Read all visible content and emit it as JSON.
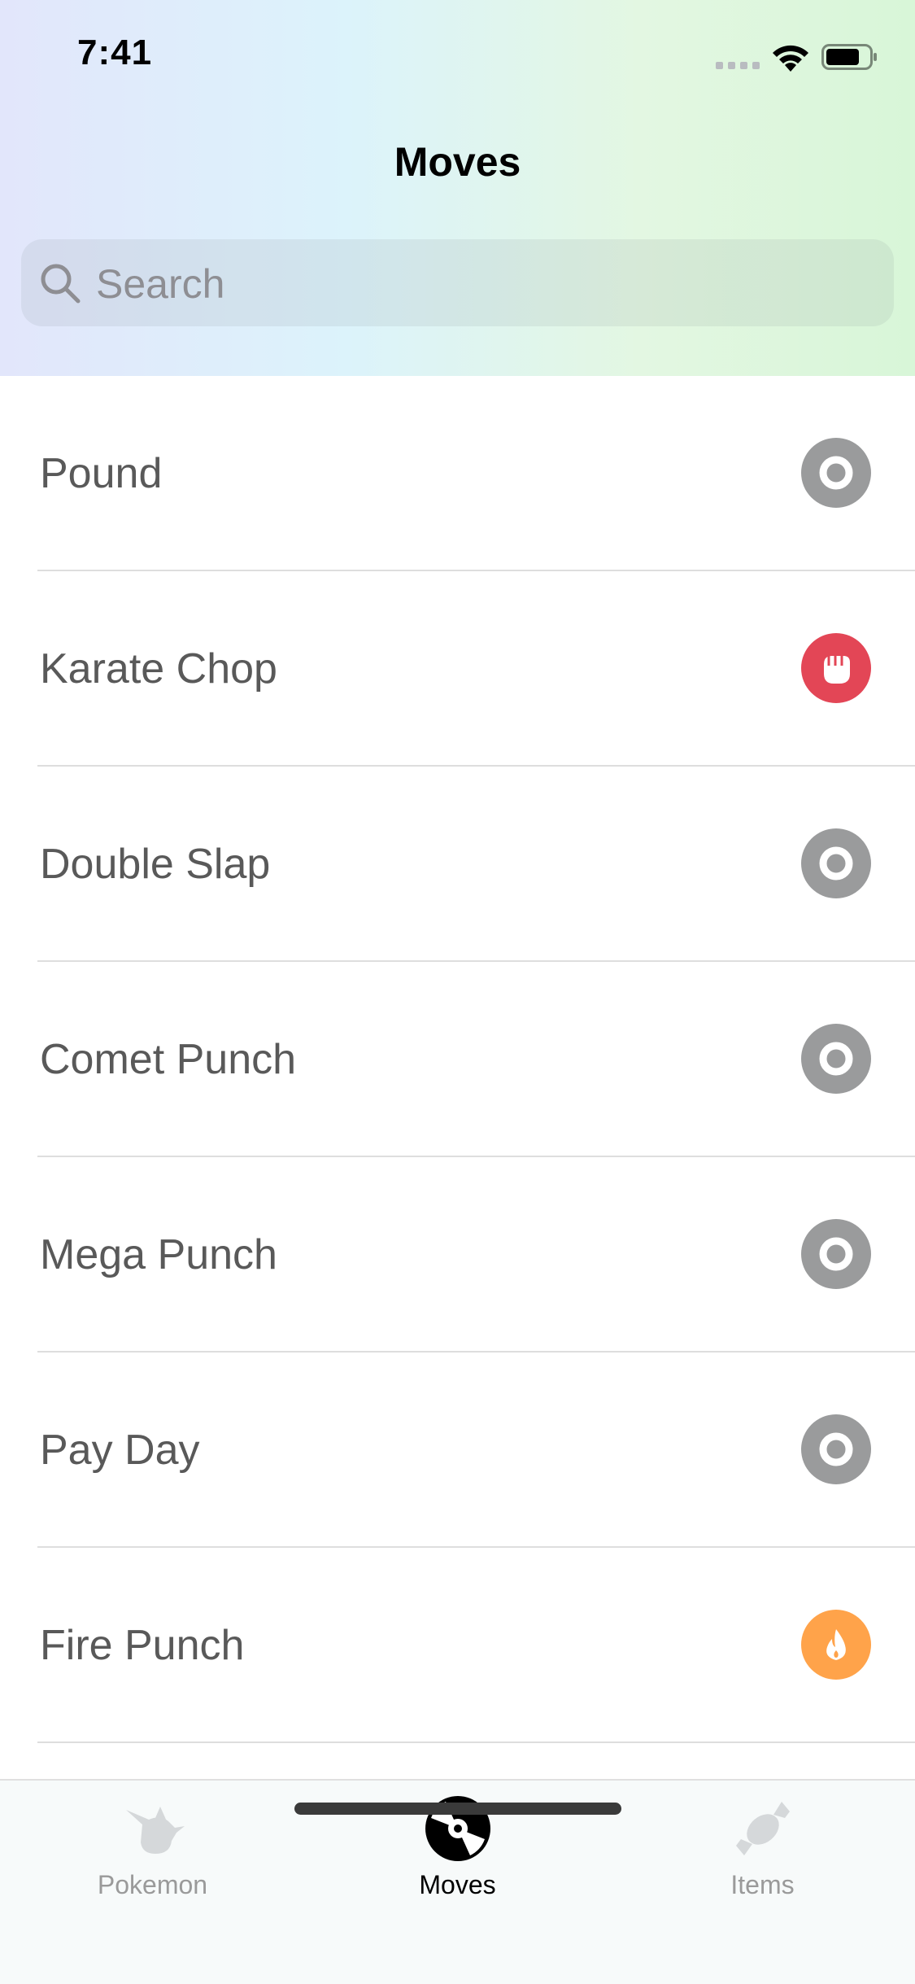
{
  "status_bar": {
    "time": "7:41"
  },
  "nav": {
    "title": "Moves"
  },
  "search": {
    "placeholder": "Search"
  },
  "moves": [
    {
      "name": "Pound",
      "type_icon": "normal-type-icon",
      "color": "#9a9b9c"
    },
    {
      "name": "Karate Chop",
      "type_icon": "fighting-type-icon",
      "color": "#e34656"
    },
    {
      "name": "Double Slap",
      "type_icon": "normal-type-icon",
      "color": "#9a9b9c"
    },
    {
      "name": "Comet Punch",
      "type_icon": "normal-type-icon",
      "color": "#9a9b9c"
    },
    {
      "name": "Mega Punch",
      "type_icon": "normal-type-icon",
      "color": "#9a9b9c"
    },
    {
      "name": "Pay Day",
      "type_icon": "normal-type-icon",
      "color": "#9a9b9c"
    },
    {
      "name": "Fire Punch",
      "type_icon": "fire-type-icon",
      "color": "#ffa34a"
    }
  ],
  "tabs": [
    {
      "label": "Pokemon",
      "icon": "pikachu-icon",
      "active": false
    },
    {
      "label": "Moves",
      "icon": "disc-icon",
      "active": true
    },
    {
      "label": "Items",
      "icon": "candy-icon",
      "active": false
    }
  ]
}
